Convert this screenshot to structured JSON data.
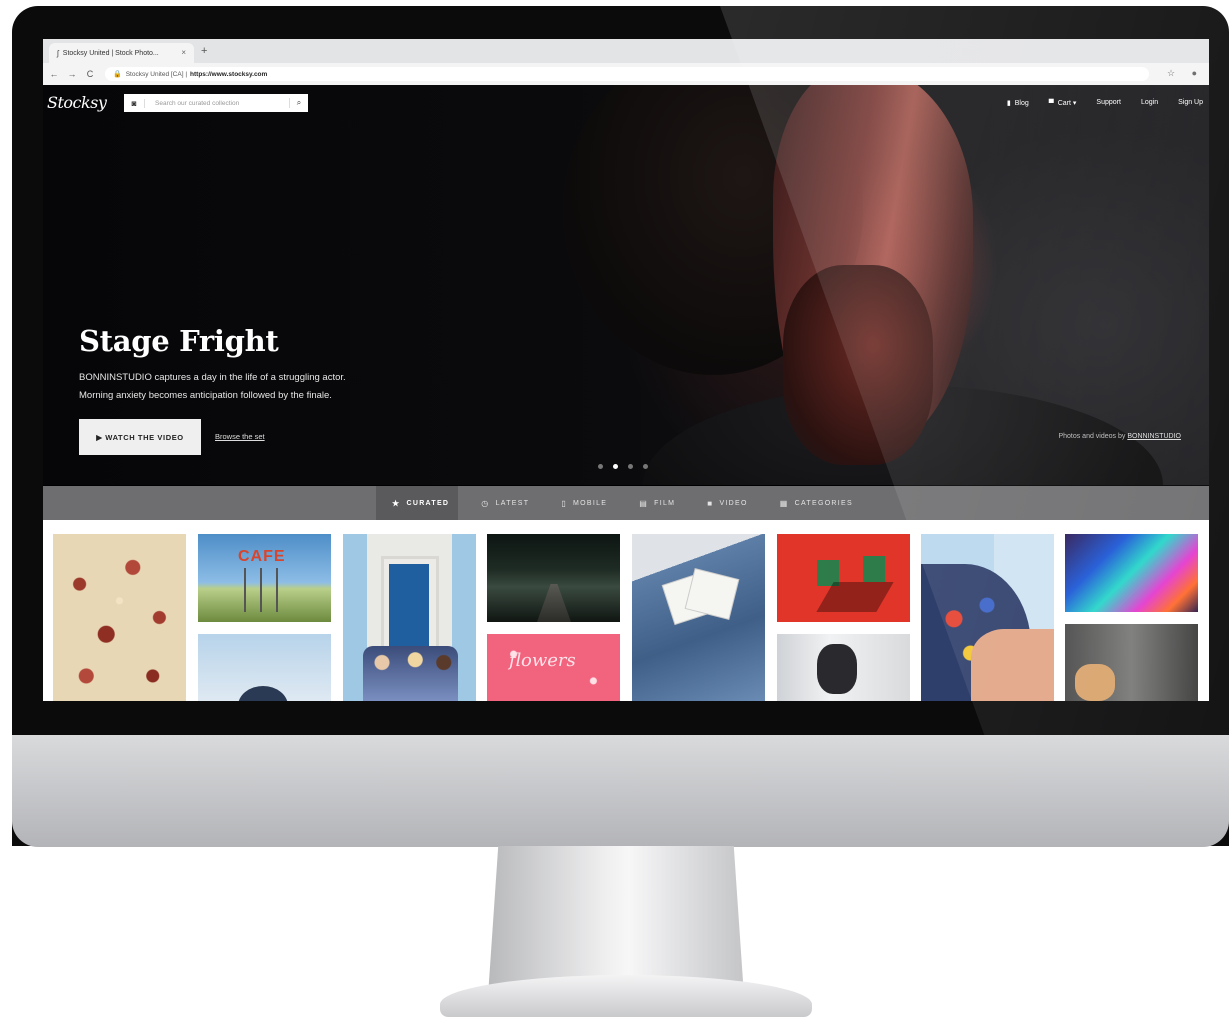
{
  "browser": {
    "tab_title": "Stocksy United | Stock Photo...",
    "tab_close": "×",
    "new_tab": "+",
    "nav_back": "←",
    "nav_forward": "→",
    "nav_reload": "C",
    "url_prefix": "Stocksy United [CA] |",
    "url_host": "https://www.stocksy.com"
  },
  "header": {
    "logo": "Stocksy",
    "search_placeholder": "Search our curated collection",
    "nav": [
      {
        "label": "Blog",
        "icon": "bookmark-icon"
      },
      {
        "label": "Cart",
        "icon": "cart-icon"
      },
      {
        "label": "Support"
      },
      {
        "label": "Login"
      },
      {
        "label": "Sign Up"
      }
    ]
  },
  "hero": {
    "title": "Stage Fright",
    "description_line1": "BONNINSTUDIO captures a day in the life of a struggling actor.",
    "description_line2": "Morning anxiety becomes anticipation followed by the finale.",
    "cta_label": "▶ WATCH THE VIDEO",
    "browse_label": "Browse the set",
    "credit_prefix": "Photos and videos by",
    "credit_name": "BONNINSTUDIO"
  },
  "categories": [
    {
      "label": "CURATED",
      "icon": "star-icon",
      "glyph": "★",
      "active": true
    },
    {
      "label": "LATEST",
      "icon": "clock-icon",
      "glyph": "◷",
      "active": false
    },
    {
      "label": "MOBILE",
      "icon": "mobile-icon",
      "glyph": "▯",
      "active": false
    },
    {
      "label": "FILM",
      "icon": "film-icon",
      "glyph": "▤",
      "active": false
    },
    {
      "label": "VIDEO",
      "icon": "video-icon",
      "glyph": "■",
      "active": false
    },
    {
      "label": "CATEGORIES",
      "icon": "grid-icon",
      "glyph": "▦",
      "active": false
    }
  ],
  "photos": {
    "cafe_sign": "CAFE",
    "flowers_script": "flowers"
  },
  "colors": {
    "category_bar": "#6e6e70",
    "category_active": "#5a5a5c",
    "hero_bg": "#0a0a0c"
  }
}
